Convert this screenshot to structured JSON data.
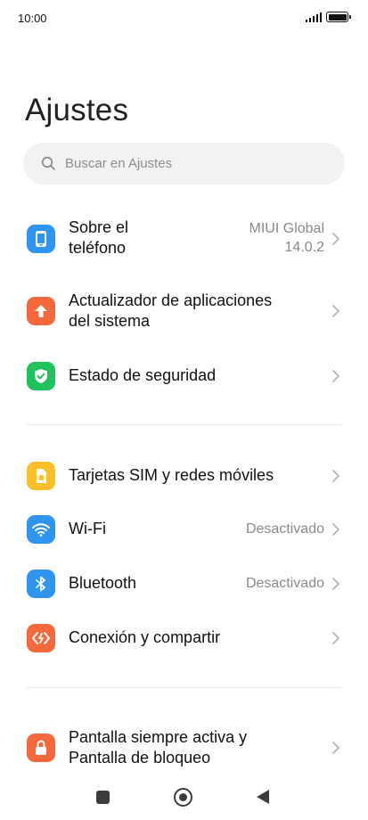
{
  "status_bar": {
    "time": "10:00"
  },
  "page": {
    "title": "Ajustes"
  },
  "search": {
    "placeholder": "Buscar en Ajustes"
  },
  "items": [
    {
      "label_line1": "Sobre el",
      "label_line2": "teléfono",
      "value_line1": "MIUI Global",
      "value_line2": "14.0.2",
      "icon": "phone-icon",
      "color": "#2f95f3"
    },
    {
      "label_line1": "Actualizador de aplicaciones",
      "label_line2": "del sistema",
      "icon": "arrow-up-icon",
      "color": "#f4683c"
    },
    {
      "label": "Estado de seguridad",
      "icon": "shield-check-icon",
      "color": "#20c25c"
    },
    {
      "label": "Tarjetas SIM y redes móviles",
      "icon": "sim-card-icon",
      "color": "#fbbf2a"
    },
    {
      "label": "Wi-Fi",
      "value": "Desactivado",
      "icon": "wifi-icon",
      "color": "#2f95f3"
    },
    {
      "label": "Bluetooth",
      "value": "Desactivado",
      "icon": "bluetooth-icon",
      "color": "#2f95f3"
    },
    {
      "label": "Conexión y compartir",
      "icon": "share-icon",
      "color": "#f4683c"
    },
    {
      "label_line1": "Pantalla siempre activa y",
      "label_line2": "Pantalla de bloqueo",
      "icon": "lock-icon",
      "color": "#f4683c"
    }
  ],
  "nav": {
    "icons": [
      "recents-icon",
      "home-icon",
      "back-icon"
    ]
  }
}
